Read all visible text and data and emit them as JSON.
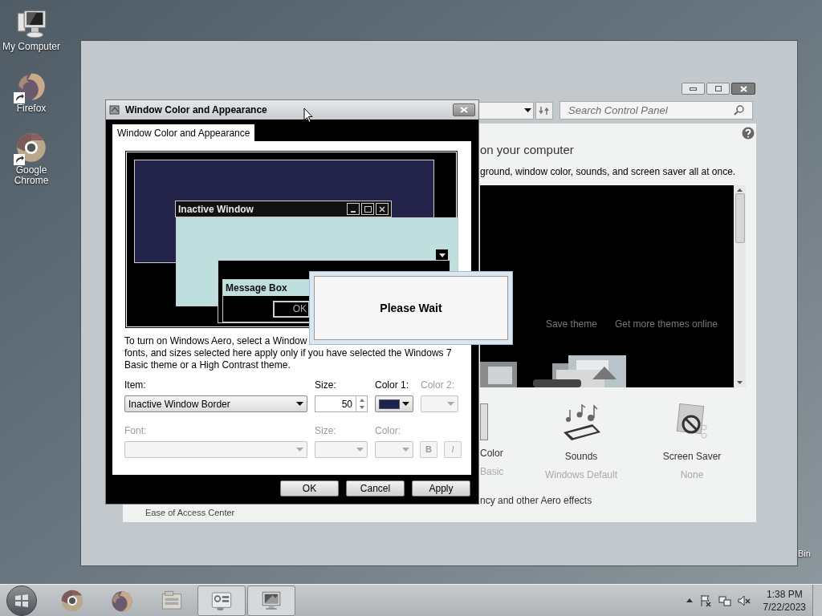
{
  "desktop_icons": [
    {
      "label": "My Computer",
      "kind": "computer",
      "shortcut": false
    },
    {
      "label": "Firefox",
      "kind": "firefox",
      "shortcut": true
    },
    {
      "label": "Google Chrome",
      "kind": "chrome",
      "shortcut": true
    }
  ],
  "recycle_bin": {
    "label": "Bin"
  },
  "control_panel": {
    "search": {
      "placeholder": "Search Control Panel"
    },
    "heading": "on your computer",
    "subtitle": "ground, window color, sounds, and screen saver all at once.",
    "theme_links": [
      "Save theme",
      "Get more themes online"
    ],
    "settings": [
      {
        "label": "Color",
        "value": "Basic",
        "kind": "color"
      },
      {
        "label": "Sounds",
        "value": "Windows Default",
        "kind": "sounds"
      },
      {
        "label": "Screen Saver",
        "value": "None",
        "kind": "screensaver"
      }
    ],
    "aero_link": "ncy and other Aero effects",
    "ease_link": "Ease of Access Center"
  },
  "dialog": {
    "title": "Window Color and Appearance",
    "tabs": [
      {
        "label": "Window Color and Appearance",
        "selected": true
      }
    ],
    "preview": {
      "inactive_title": "Inactive Window",
      "message_title": "Message Box",
      "ok": "OK"
    },
    "description": [
      "To turn on Windows Aero, select a Window",
      "fonts, and sizes selected here apply only if you have selected the Windows 7",
      "Basic theme or a High Contrast theme."
    ],
    "item": {
      "label": "Item:",
      "value": "Inactive Window Border",
      "disabled": false
    },
    "size": {
      "label": "Size:",
      "value": "50",
      "disabled": false
    },
    "color1": {
      "label": "Color 1:",
      "color": "#1f2150",
      "disabled": false
    },
    "color2": {
      "label": "Color 2:",
      "disabled": true
    },
    "font": {
      "label": "Font:",
      "disabled": true
    },
    "font_size": {
      "label": "Size:",
      "disabled": true
    },
    "font_color": {
      "label": "Color:",
      "disabled": true
    },
    "bold": {
      "label": "B",
      "disabled": true
    },
    "italic": {
      "label": "I",
      "disabled": true
    },
    "buttons": [
      "OK",
      "Cancel",
      "Apply"
    ]
  },
  "please_wait": {
    "text": "Please Wait"
  },
  "taskbar": {
    "apps": [
      {
        "kind": "chrome",
        "active": false
      },
      {
        "kind": "firefox",
        "active": false
      },
      {
        "kind": "explorer",
        "active": false
      },
      {
        "kind": "control",
        "active": true
      },
      {
        "kind": "display",
        "active": true
      }
    ],
    "clock": {
      "time": "1:38 PM",
      "date": "7/22/2023"
    }
  }
}
